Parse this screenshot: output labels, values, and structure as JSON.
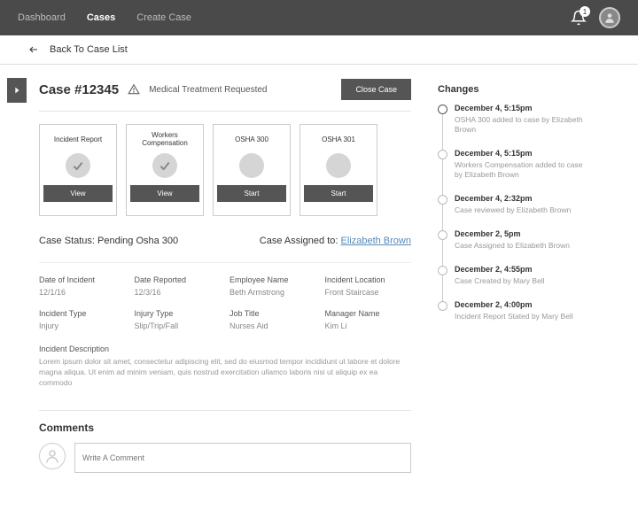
{
  "nav": {
    "dashboard": "Dashboard",
    "cases": "Cases",
    "create": "Create Case",
    "notif_count": "1"
  },
  "backbar": {
    "label": "Back To Case List"
  },
  "case": {
    "title": "Case #12345",
    "flag": "Medical Treatment Requested",
    "close_btn": "Close Case"
  },
  "cards": [
    {
      "title": "Incident Report",
      "btn": "View",
      "done": true
    },
    {
      "title": "Workers Compensation",
      "btn": "View",
      "done": true
    },
    {
      "title": "OSHA 300",
      "btn": "Start",
      "done": false
    },
    {
      "title": "OSHA 301",
      "btn": "Start",
      "done": false
    }
  ],
  "status": {
    "label": "Case Status: Pending Osha 300",
    "assigned_prefix": "Case Assigned to:",
    "assigned_name": "Elizabeth Brown"
  },
  "details": [
    {
      "label": "Date of Incident",
      "value": "12/1/16"
    },
    {
      "label": "Date Reported",
      "value": "12/3/16"
    },
    {
      "label": "Employee Name",
      "value": "Beth Armstrong"
    },
    {
      "label": "Incident Location",
      "value": "Front Staircase"
    },
    {
      "label": "Incident Type",
      "value": "Injury"
    },
    {
      "label": "Injury Type",
      "value": "Slip/Trip/Fall"
    },
    {
      "label": "Job Title",
      "value": "Nurses Aid"
    },
    {
      "label": "Manager Name",
      "value": "Kim Li"
    }
  ],
  "description": {
    "label": "Incident Description",
    "text": "Lorem ipsum dolor sit amet, consectetur adipiscing elit, sed do eiusmod tempor incididunt ut labore et dolore magna aliqua. Ut enim ad minim veniam, quis nostrud exercitation ullamco laboris nisi ut aliquip ex ea commodo"
  },
  "comments": {
    "title": "Comments",
    "placeholder": "Write A Comment"
  },
  "changes": {
    "title": "Changes",
    "items": [
      {
        "time": "December 4, 5:15pm",
        "desc": "OSHA 300 added to case by Elizabeth Brown",
        "current": true
      },
      {
        "time": "December 4, 5:15pm",
        "desc": "Workers Compensation added to case by Elizabeth Brown",
        "current": false
      },
      {
        "time": "December 4, 2:32pm",
        "desc": "Case reviewed by Elizabeth Brown",
        "current": false
      },
      {
        "time": "December 2, 5pm",
        "desc": "Case Assigned to Elizabeth Brown",
        "current": false
      },
      {
        "time": "December 2, 4:55pm",
        "desc": "Case Created by Mary Bell",
        "current": false
      },
      {
        "time": "December 2, 4:00pm",
        "desc": "Incident Report Stated by  Mary Bell",
        "current": false
      }
    ]
  }
}
